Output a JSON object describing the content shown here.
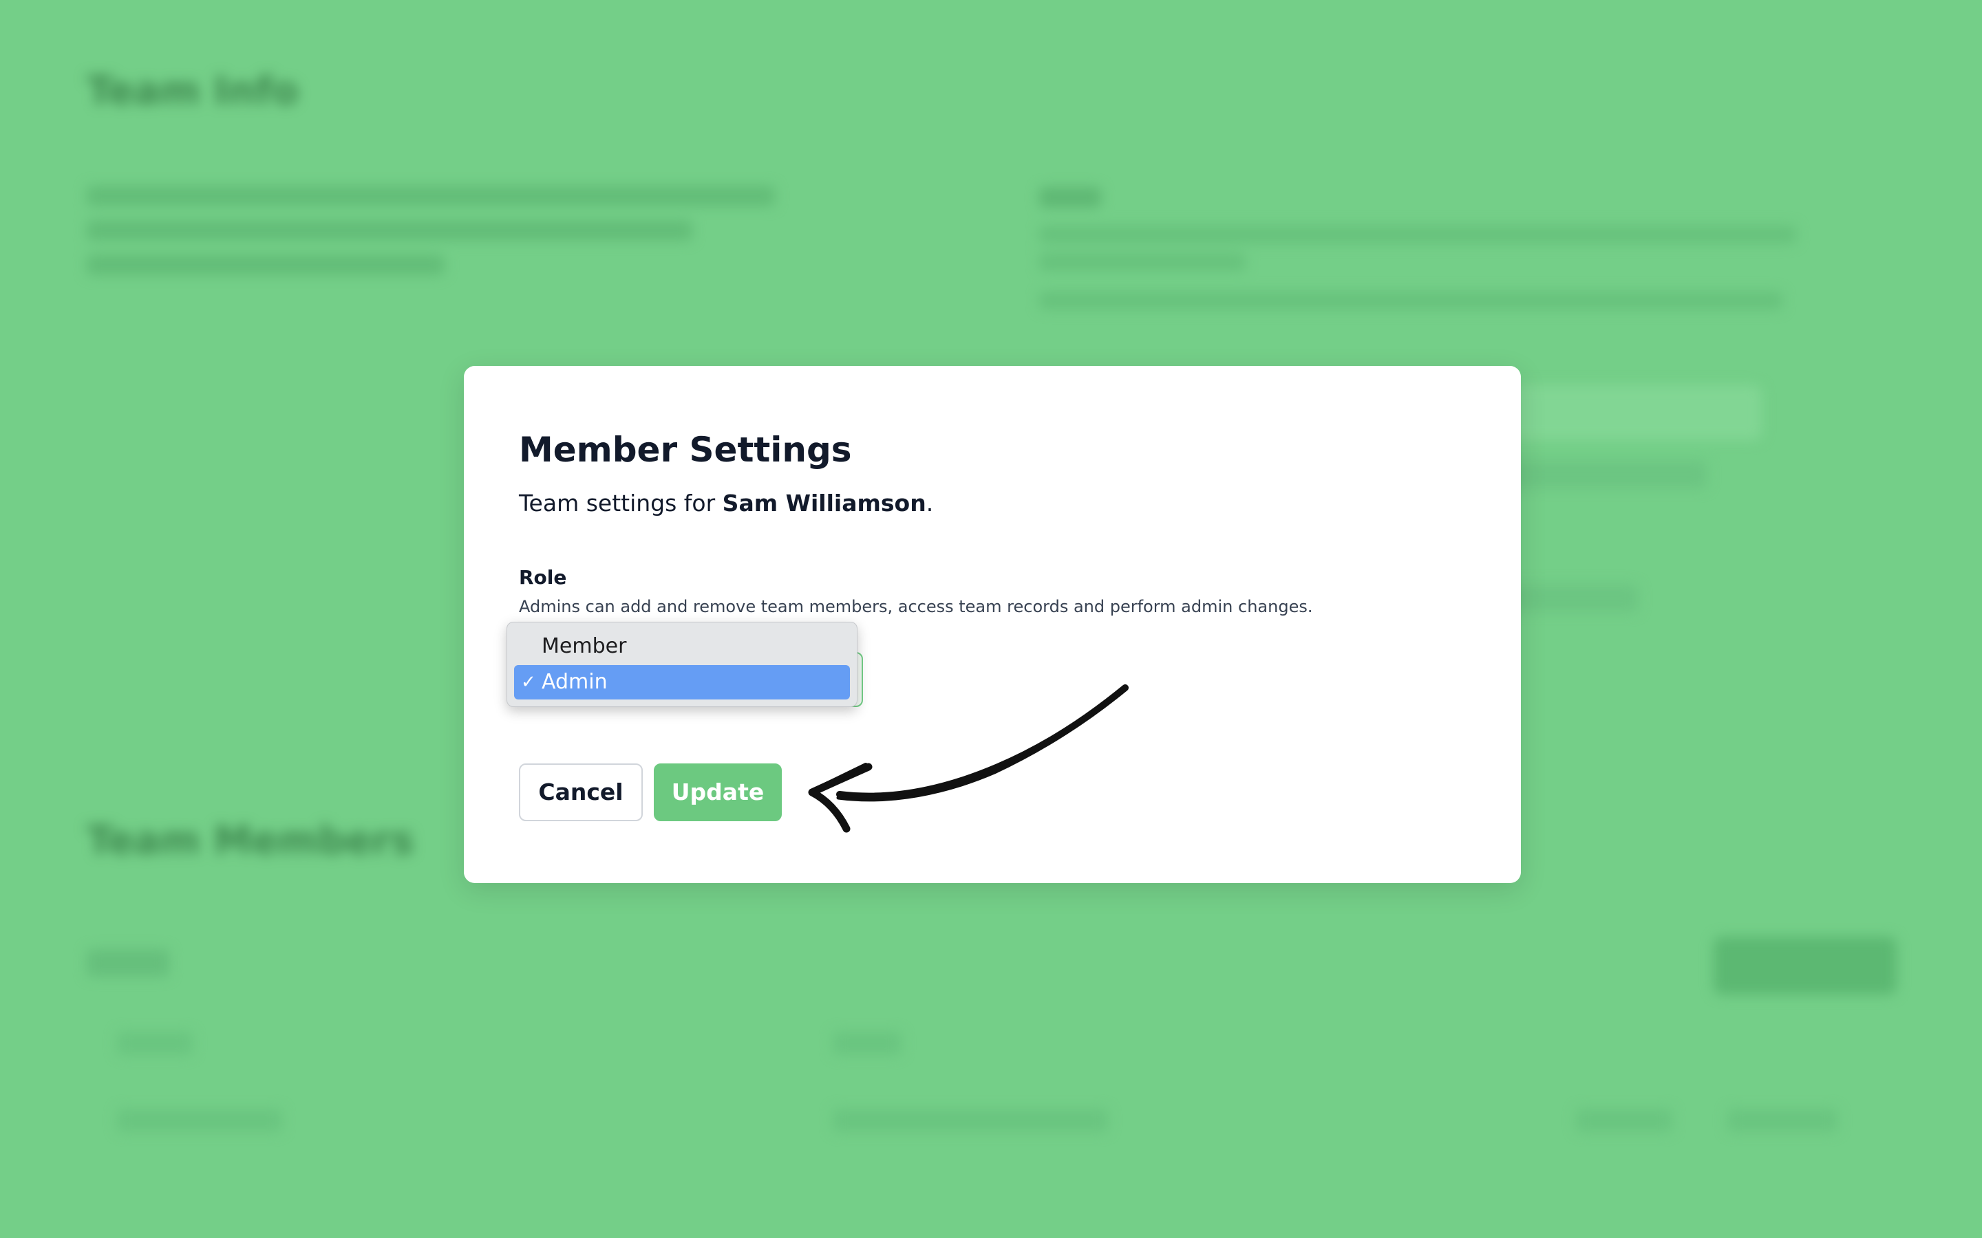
{
  "background": {
    "color": "#74cf88",
    "title": "Team Info",
    "members_title": "Team Members"
  },
  "modal": {
    "title": "Member Settings",
    "subtitle_prefix": "Team settings for ",
    "member_name": "Sam Williamson",
    "subtitle_suffix": ".",
    "role_label": "Role",
    "role_help": "Admins can add and remove team members, access team records and perform admin changes.",
    "role_options": [
      {
        "label": "Member",
        "selected": false
      },
      {
        "label": "Admin",
        "selected": true
      }
    ],
    "checkmark": "✓",
    "cancel_label": "Cancel",
    "update_label": "Update",
    "accent_color": "#6cc980",
    "selection_color": "#659df4"
  },
  "annotation": {
    "icon": "hand-drawn-arrow-icon"
  }
}
